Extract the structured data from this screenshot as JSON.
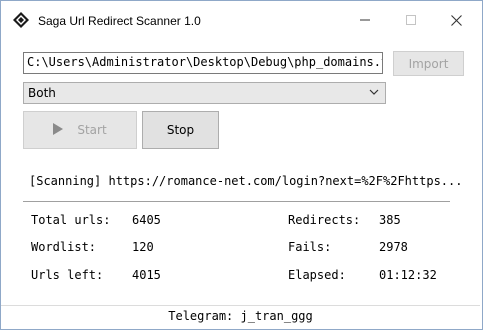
{
  "window": {
    "title": "Saga Url Redirect Scanner 1.0",
    "icon": "saga-diamond-icon"
  },
  "controls": {
    "path_value": "C:\\Users\\Administrator\\Desktop\\Debug\\php_domains.txt",
    "import_label": "Import",
    "mode_selected": "Both",
    "start_label": "Start",
    "stop_label": "Stop"
  },
  "status": {
    "text": "[Scanning] https://romance-net.com/login?next=%2F%2Fhttps..."
  },
  "stats": {
    "total_urls_label": "Total urls:",
    "total_urls_value": "6405",
    "wordlist_label": "Wordlist:",
    "wordlist_value": "120",
    "urls_left_label": "Urls left:",
    "urls_left_value": "4015",
    "redirects_label": "Redirects:",
    "redirects_value": "385",
    "fails_label": "Fails:",
    "fails_value": "2978",
    "elapsed_label": "Elapsed:",
    "elapsed_value": "01:12:32"
  },
  "footer": {
    "telegram": "Telegram: j_tran_ggg"
  }
}
